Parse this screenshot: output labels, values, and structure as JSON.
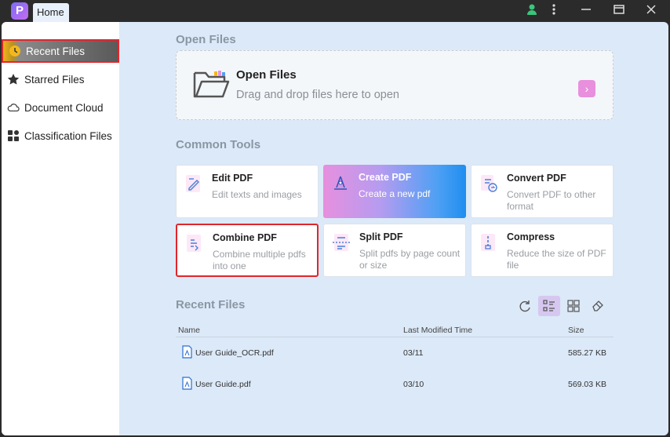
{
  "titlebar": {
    "logo_letter": "P",
    "tab_label": "Home",
    "icons": [
      "user-icon",
      "more-vertical-icon",
      "minimize-icon",
      "maximize-icon",
      "close-icon"
    ]
  },
  "sidebar": {
    "items": [
      {
        "label": "Recent Files",
        "icon": "clock-icon",
        "active": true
      },
      {
        "label": "Starred Files",
        "icon": "star-icon",
        "active": false
      },
      {
        "label": "Document Cloud",
        "icon": "cloud-icon",
        "active": false
      },
      {
        "label": "Classification Files",
        "icon": "grid-icon",
        "active": false
      }
    ]
  },
  "open_files": {
    "section_title": "Open Files",
    "title": "Open Files",
    "subtitle": "Drag and drop files here to open"
  },
  "common_tools": {
    "section_title": "Common Tools",
    "tools": [
      {
        "title": "Edit PDF",
        "desc": "Edit texts and images"
      },
      {
        "title": "Create PDF",
        "desc": "Create a new pdf"
      },
      {
        "title": "Convert PDF",
        "desc": "Convert PDF to other format"
      },
      {
        "title": "Combine PDF",
        "desc": "Combine multiple pdfs into one"
      },
      {
        "title": "Split PDF",
        "desc": "Split pdfs by page count or size"
      },
      {
        "title": "Compress",
        "desc": "Reduce the size of PDF file"
      }
    ]
  },
  "recent_files": {
    "section_title": "Recent Files",
    "columns": {
      "name": "Name",
      "modified": "Last Modified Time",
      "size": "Size"
    },
    "rows": [
      {
        "name": "User Guide_OCR.pdf",
        "modified": "03/11",
        "size": "585.27 KB"
      },
      {
        "name": "User Guide.pdf",
        "modified": "03/10",
        "size": "569.03 KB"
      }
    ]
  },
  "colors": {
    "accent_pink": "#e88fdd",
    "highlight_red": "#e0262b",
    "create_gradient_end": "#1f8ef0"
  }
}
